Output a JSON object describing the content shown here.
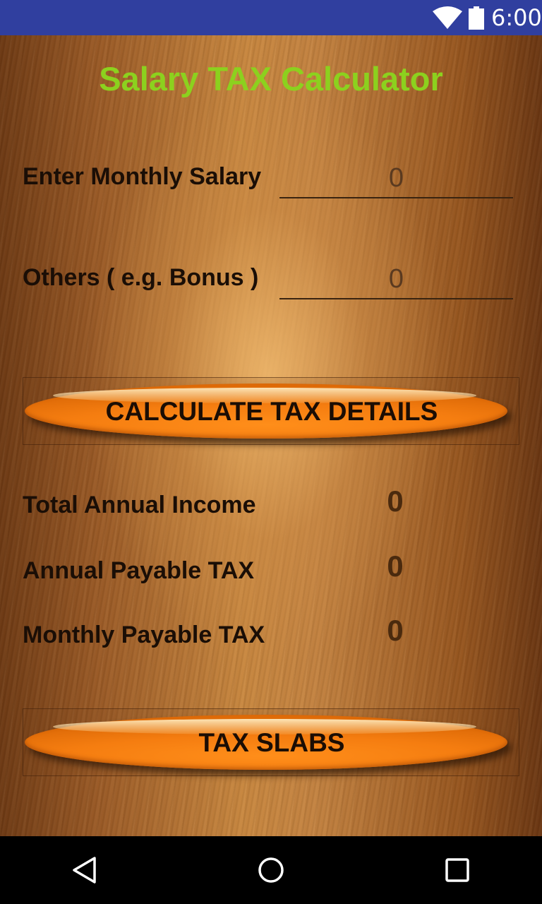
{
  "status_bar": {
    "time": "6:00",
    "icons": [
      "wifi-icon",
      "battery-icon"
    ]
  },
  "app": {
    "title": "Salary TAX Calculator",
    "title_color": "#8cd11e",
    "monthly_salary": {
      "label": "Enter Monthly Salary",
      "placeholder": "0",
      "value": ""
    },
    "others": {
      "label": "Others ( e.g. Bonus )",
      "placeholder": "0",
      "value": ""
    },
    "calculate_button": {
      "label": "CALCULATE TAX DETAILS"
    },
    "results": [
      {
        "label": "Total Annual Income",
        "value": "0"
      },
      {
        "label": "Annual Payable TAX",
        "value": "0"
      },
      {
        "label": "Monthly Payable TAX",
        "value": "0"
      }
    ],
    "tax_slabs_button": {
      "label": "TAX SLABS"
    },
    "button_color": "#f57d10"
  },
  "nav_bar": {
    "icons": [
      "back-icon",
      "home-icon",
      "recent-apps-icon"
    ]
  }
}
